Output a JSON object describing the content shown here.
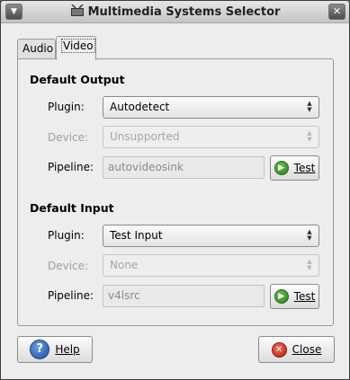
{
  "window": {
    "title": "Multimedia Systems Selector"
  },
  "tabs": [
    {
      "label": "Audio",
      "selected": false
    },
    {
      "label": "Video",
      "selected": true
    }
  ],
  "output": {
    "heading": "Default Output",
    "plugin_label": "Plugin:",
    "plugin_value": "Autodetect",
    "device_label": "Device:",
    "device_value": "Unsupported",
    "pipeline_label": "Pipeline:",
    "pipeline_value": "autovideosink",
    "test_label": "Test"
  },
  "input": {
    "heading": "Default Input",
    "plugin_label": "Plugin:",
    "plugin_value": "Test Input",
    "device_label": "Device:",
    "device_value": "None",
    "pipeline_label": "Pipeline:",
    "pipeline_value": "v4lsrc",
    "test_label": "Test"
  },
  "footer": {
    "help_label": "Help",
    "close_label": "Close"
  },
  "icons": {
    "window_menu": "chevron-down-icon",
    "window_close": "close-icon",
    "app": "multimedia-icon",
    "test": "play-icon",
    "help": "help-icon",
    "close": "close-circle-icon"
  }
}
